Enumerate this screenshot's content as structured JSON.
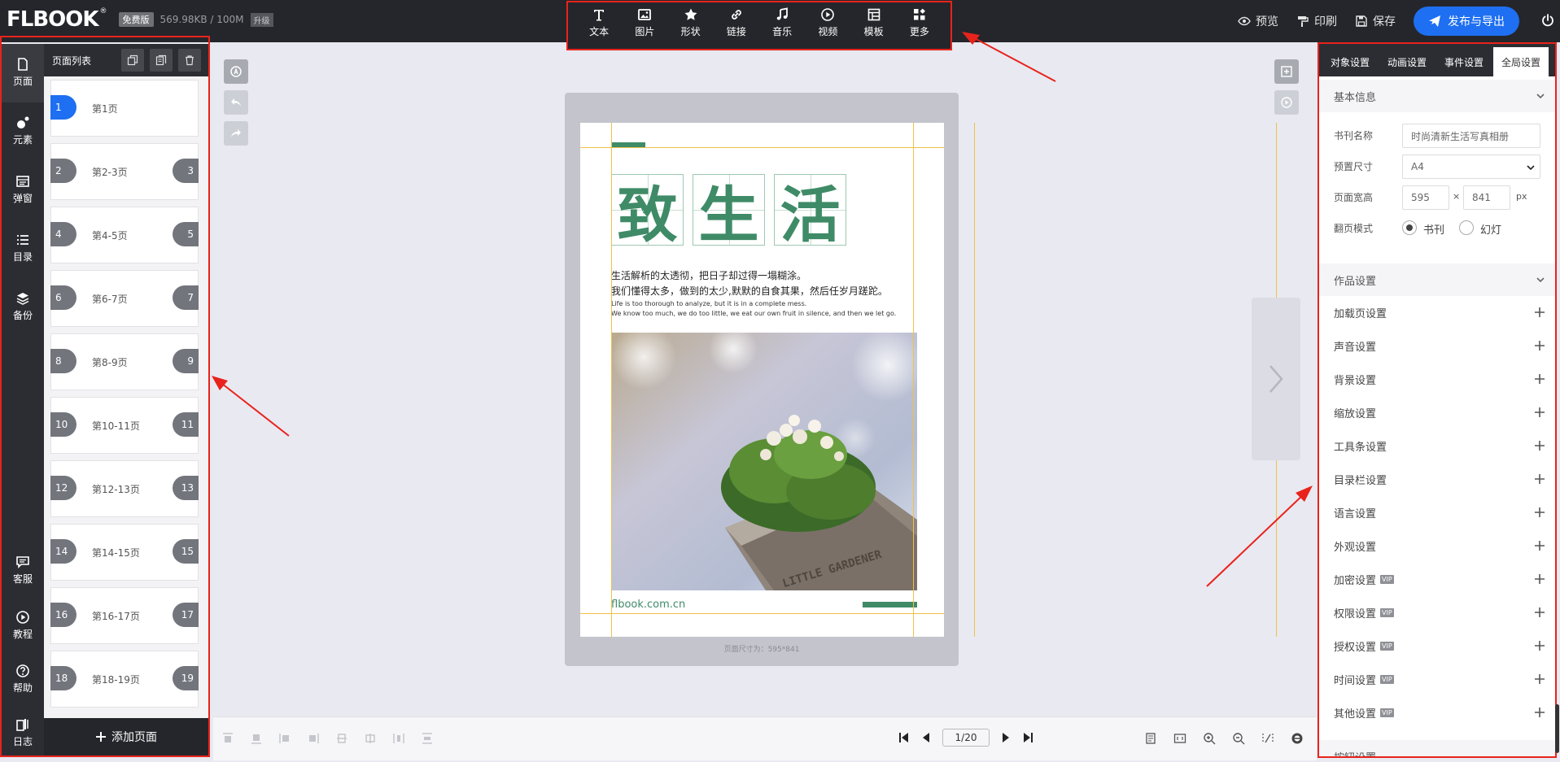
{
  "header": {
    "logo": "FLBOOK",
    "logo_sup": "®",
    "plan_badge": "免费版",
    "storage": "569.98KB / 100M",
    "upgrade": "升级",
    "actions": {
      "preview": "预览",
      "print": "印刷",
      "save": "保存"
    },
    "publish": "发布与导出"
  },
  "toolbar": [
    {
      "label": "文本",
      "icon": "text-icon"
    },
    {
      "label": "图片",
      "icon": "image-icon"
    },
    {
      "label": "形状",
      "icon": "star-icon"
    },
    {
      "label": "链接",
      "icon": "link-icon"
    },
    {
      "label": "音乐",
      "icon": "music-icon"
    },
    {
      "label": "视频",
      "icon": "play-circle-icon"
    },
    {
      "label": "模板",
      "icon": "template-icon"
    },
    {
      "label": "更多",
      "icon": "more-grid-icon"
    }
  ],
  "rail": {
    "page": "页面",
    "element": "元素",
    "popup": "弹窗",
    "toc": "目录",
    "backup": "备份",
    "service": "客服",
    "tutorial": "教程",
    "help": "帮助",
    "log": "日志"
  },
  "pagelist": {
    "title": "页面列表",
    "items": [
      {
        "label": "第1页",
        "left": "1",
        "right": ""
      },
      {
        "label": "第2-3页",
        "left": "2",
        "right": "3"
      },
      {
        "label": "第4-5页",
        "left": "4",
        "right": "5"
      },
      {
        "label": "第6-7页",
        "left": "6",
        "right": "7"
      },
      {
        "label": "第8-9页",
        "left": "8",
        "right": "9"
      },
      {
        "label": "第10-11页",
        "left": "10",
        "right": "11"
      },
      {
        "label": "第12-13页",
        "left": "12",
        "right": "13"
      },
      {
        "label": "第14-15页",
        "left": "14",
        "right": "15"
      },
      {
        "label": "第16-17页",
        "left": "16",
        "right": "17"
      },
      {
        "label": "第18-19页",
        "left": "18",
        "right": "19"
      }
    ],
    "add": "添加页面"
  },
  "canvas": {
    "title_chars": [
      "致",
      "生",
      "活"
    ],
    "zh_line1": "生活解析的太透彻，把日子却过得一塌糊涂。",
    "zh_line2": "我们懂得太多，做到的太少,默默的自食其果，然后任岁月蹉跎。",
    "en_line1": "Life is too thorough to analyze, but it is in a complete mess.",
    "en_line2": "We know too much, we do too little, we eat our own fruit in silence, and then we let go.",
    "site": "flbook.com.cn",
    "pot_text": "LITTLE GARDENER",
    "size_note": "页面尺寸为：595*841"
  },
  "pager": {
    "value": "1/20"
  },
  "right_panel": {
    "tabs": [
      "对象设置",
      "动画设置",
      "事件设置",
      "全局设置"
    ],
    "active_tab": 3,
    "basic": {
      "title": "基本信息",
      "name_label": "书刊名称",
      "name_value": "时尚清新生活写真相册",
      "preset_label": "预置尺寸",
      "preset_value": "A4",
      "size_label": "页面宽高",
      "width": "595",
      "times": "×",
      "height": "841",
      "unit": "px",
      "flip_label": "翻页模式",
      "flip_book": "书刊",
      "flip_slide": "幻灯"
    },
    "work": {
      "title": "作品设置",
      "options": [
        {
          "label": "加载页设置",
          "vip": ""
        },
        {
          "label": "声音设置",
          "vip": ""
        },
        {
          "label": "背景设置",
          "vip": ""
        },
        {
          "label": "缩放设置",
          "vip": ""
        },
        {
          "label": "工具条设置",
          "vip": ""
        },
        {
          "label": "目录栏设置",
          "vip": ""
        },
        {
          "label": "语言设置",
          "vip": ""
        },
        {
          "label": "外观设置",
          "vip": ""
        },
        {
          "label": "加密设置",
          "vip": "VIP"
        },
        {
          "label": "权限设置",
          "vip": "VIP"
        },
        {
          "label": "授权设置",
          "vip": "VIP"
        },
        {
          "label": "时间设置",
          "vip": "VIP"
        },
        {
          "label": "其他设置",
          "vip": "VIP"
        }
      ],
      "next_section": "按钮设置"
    }
  },
  "colors": {
    "accent": "#1e6ff1",
    "highlight": "#e8231c",
    "title_green": "#3f8b67",
    "guide": "#f1c04a"
  }
}
